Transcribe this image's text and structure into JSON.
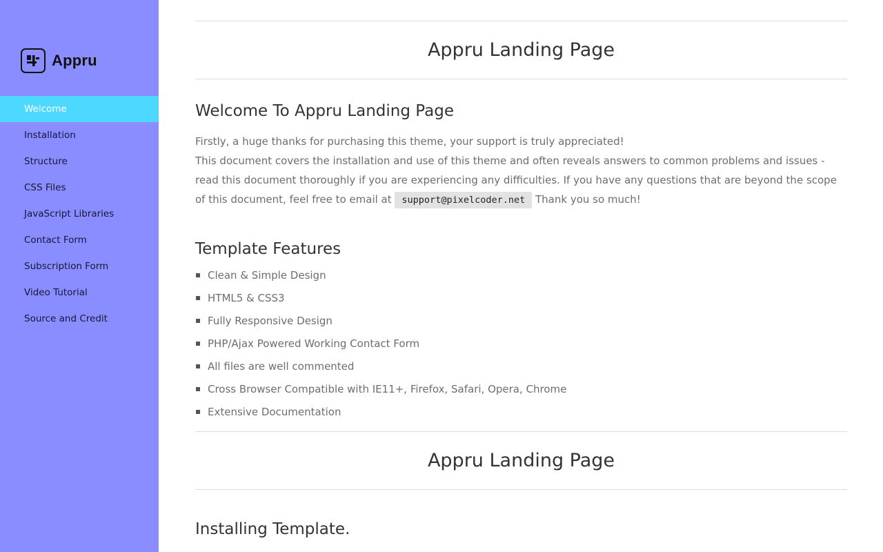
{
  "brand": {
    "name": "Appru"
  },
  "colors": {
    "sidebar_bg": "#8a8dff",
    "active_item_bg": "#4dd9ff"
  },
  "sidebar": {
    "items": [
      {
        "label": "Welcome",
        "active": true
      },
      {
        "label": "Installation"
      },
      {
        "label": "Structure"
      },
      {
        "label": "CSS Files"
      },
      {
        "label": "JavaScript Libraries"
      },
      {
        "label": "Contact Form"
      },
      {
        "label": "Subscription Form"
      },
      {
        "label": "Video Tutorial"
      },
      {
        "label": "Source and Credit"
      }
    ]
  },
  "banner1": {
    "title": "Appru Landing Page"
  },
  "welcome": {
    "heading": "Welcome To Appru Landing Page",
    "line1": "Firstly, a huge thanks for purchasing this theme, your support is truly appreciated!",
    "line2": "This document covers the installation and use of this theme and often reveals answers to common problems and issues - read this document thoroughly if you are experiencing any difficulties. If you have any questions that are beyond the scope of this document, feel free to email at",
    "email": "support@pixelcoder.net",
    "line3": "Thank you so much!"
  },
  "features": {
    "heading": "Template Features",
    "items": [
      "Clean & Simple Design",
      "HTML5 & CSS3",
      "Fully Responsive Design",
      "PHP/Ajax Powered Working Contact Form",
      "All files are well commented",
      "Cross Browser Compatible with IE11+, Firefox, Safari, Opera, Chrome",
      "Extensive Documentation"
    ]
  },
  "banner2": {
    "title": "Appru Landing Page"
  },
  "installing": {
    "heading": "Installing Template."
  }
}
